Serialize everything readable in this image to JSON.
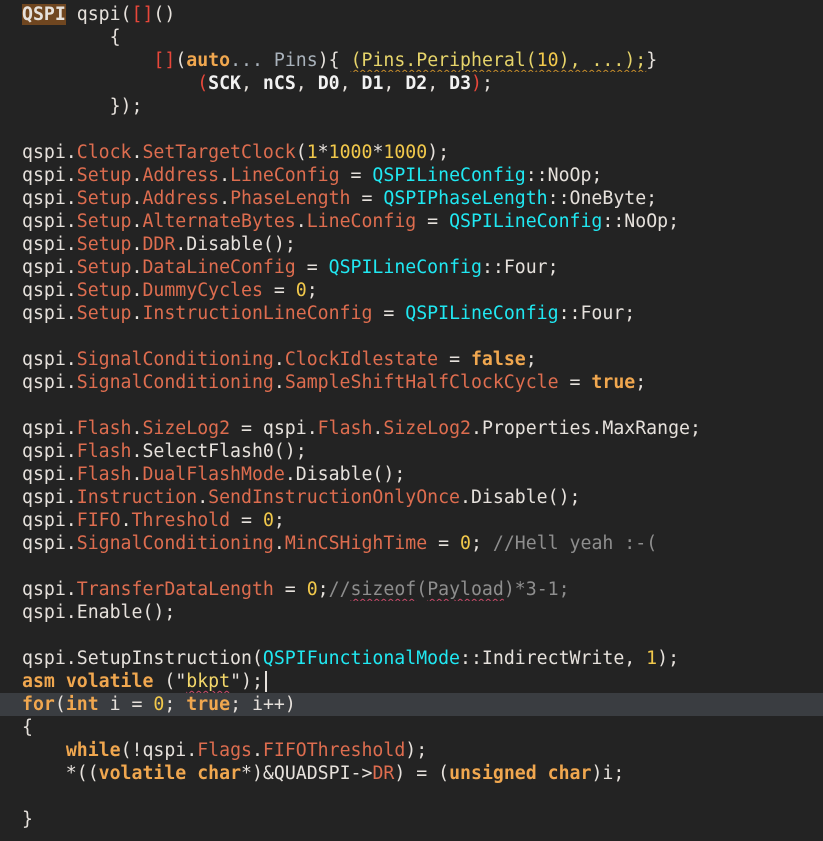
{
  "editor": {
    "background": "#232323",
    "current_line_background": "#3a3d41",
    "current_line": 30,
    "colors": {
      "plain": "#e6e1dc",
      "member": "#de6d4f",
      "type": "#20e8f2",
      "number": "#f1c84b",
      "keyword": "#f0a74f",
      "comment": "#8e8e8e",
      "string": "#f3d76a",
      "bracket": "#e8473a"
    },
    "lines": [
      [
        [
          "highlight",
          "QSPI"
        ],
        [
          "plain",
          " qspi("
        ],
        [
          "bracket",
          "[]"
        ],
        [
          "plain",
          "()"
        ]
      ],
      [
        [
          "plain",
          "        {"
        ]
      ],
      [
        [
          "plain",
          "            "
        ],
        [
          "bracket",
          "[]"
        ],
        [
          "plain",
          "("
        ],
        [
          "keyword",
          "auto"
        ],
        [
          "dim",
          "..."
        ],
        [
          "plain",
          " "
        ],
        [
          "dim",
          "Pins"
        ],
        [
          "plain",
          "){ "
        ],
        [
          "warn",
          "(Pins.Peripheral("
        ],
        [
          "warnnum",
          "10"
        ],
        [
          "warn"
        ],
        [
          "warn",
          "), ...);"
        ],
        [
          "plain",
          "}"
        ]
      ],
      [
        [
          "plain",
          "                "
        ],
        [
          "bracket",
          "("
        ],
        [
          "param",
          "SCK"
        ],
        [
          "plain",
          ", "
        ],
        [
          "param",
          "nCS"
        ],
        [
          "plain",
          ", "
        ],
        [
          "param",
          "D0"
        ],
        [
          "plain",
          ", "
        ],
        [
          "param",
          "D1"
        ],
        [
          "plain",
          ", "
        ],
        [
          "param",
          "D2"
        ],
        [
          "plain",
          ", "
        ],
        [
          "param",
          "D3"
        ],
        [
          "bracket",
          ")"
        ],
        [
          "plain",
          ";"
        ]
      ],
      [
        [
          "plain",
          "        });"
        ]
      ],
      [],
      [
        [
          "plain",
          "qspi."
        ],
        [
          "member",
          "Clock"
        ],
        [
          "plain",
          "."
        ],
        [
          "member",
          "SetTargetClock"
        ],
        [
          "plain",
          "("
        ],
        [
          "number",
          "1"
        ],
        [
          "plain",
          "*"
        ],
        [
          "number",
          "1000"
        ],
        [
          "plain",
          "*"
        ],
        [
          "number",
          "1000"
        ],
        [
          "plain",
          ");"
        ]
      ],
      [
        [
          "plain",
          "qspi."
        ],
        [
          "member",
          "Setup"
        ],
        [
          "plain",
          "."
        ],
        [
          "member",
          "Address"
        ],
        [
          "plain",
          "."
        ],
        [
          "member",
          "LineConfig"
        ],
        [
          "plain",
          " = "
        ],
        [
          "type",
          "QSPILineConfig"
        ],
        [
          "plain",
          "::NoOp;"
        ]
      ],
      [
        [
          "plain",
          "qspi."
        ],
        [
          "member",
          "Setup"
        ],
        [
          "plain",
          "."
        ],
        [
          "member",
          "Address"
        ],
        [
          "plain",
          "."
        ],
        [
          "member",
          "PhaseLength"
        ],
        [
          "plain",
          " = "
        ],
        [
          "type",
          "QSPIPhaseLength"
        ],
        [
          "plain",
          "::OneByte;"
        ]
      ],
      [
        [
          "plain",
          "qspi."
        ],
        [
          "member",
          "Setup"
        ],
        [
          "plain",
          "."
        ],
        [
          "member",
          "AlternateBytes"
        ],
        [
          "plain",
          "."
        ],
        [
          "member",
          "LineConfig"
        ],
        [
          "plain",
          " = "
        ],
        [
          "type",
          "QSPILineConfig"
        ],
        [
          "plain",
          "::NoOp;"
        ]
      ],
      [
        [
          "plain",
          "qspi."
        ],
        [
          "member",
          "Setup"
        ],
        [
          "plain",
          "."
        ],
        [
          "member",
          "DDR"
        ],
        [
          "plain",
          "."
        ],
        [
          "plain",
          "Disable();"
        ]
      ],
      [
        [
          "plain",
          "qspi."
        ],
        [
          "member",
          "Setup"
        ],
        [
          "plain",
          "."
        ],
        [
          "member",
          "DataLineConfig"
        ],
        [
          "plain",
          " = "
        ],
        [
          "type",
          "QSPILineConfig"
        ],
        [
          "plain",
          "::Four;"
        ]
      ],
      [
        [
          "plain",
          "qspi."
        ],
        [
          "member",
          "Setup"
        ],
        [
          "plain",
          "."
        ],
        [
          "member",
          "DummyCycles"
        ],
        [
          "plain",
          " = "
        ],
        [
          "number",
          "0"
        ],
        [
          "plain",
          ";"
        ]
      ],
      [
        [
          "plain",
          "qspi."
        ],
        [
          "member",
          "Setup"
        ],
        [
          "plain",
          "."
        ],
        [
          "member",
          "InstructionLineConfig"
        ],
        [
          "plain",
          " = "
        ],
        [
          "type",
          "QSPILineConfig"
        ],
        [
          "plain",
          "::Four;"
        ]
      ],
      [],
      [
        [
          "plain",
          "qspi."
        ],
        [
          "member",
          "SignalConditioning"
        ],
        [
          "plain",
          "."
        ],
        [
          "member",
          "ClockIdlestate"
        ],
        [
          "plain",
          " = "
        ],
        [
          "bool",
          "false"
        ],
        [
          "plain",
          ";"
        ]
      ],
      [
        [
          "plain",
          "qspi."
        ],
        [
          "member",
          "SignalConditioning"
        ],
        [
          "plain",
          "."
        ],
        [
          "member",
          "SampleShiftHalfClockCycle"
        ],
        [
          "plain",
          " = "
        ],
        [
          "bool",
          "true"
        ],
        [
          "plain",
          ";"
        ]
      ],
      [],
      [
        [
          "plain",
          "qspi."
        ],
        [
          "member",
          "Flash"
        ],
        [
          "plain",
          "."
        ],
        [
          "member",
          "SizeLog2"
        ],
        [
          "plain",
          " = qspi."
        ],
        [
          "member",
          "Flash"
        ],
        [
          "plain",
          "."
        ],
        [
          "member",
          "SizeLog2"
        ],
        [
          "plain",
          "."
        ],
        [
          "plain",
          "Properties.MaxRange;"
        ]
      ],
      [
        [
          "plain",
          "qspi."
        ],
        [
          "member",
          "Flash"
        ],
        [
          "plain",
          "."
        ],
        [
          "plain",
          "SelectFlash0();"
        ]
      ],
      [
        [
          "plain",
          "qspi."
        ],
        [
          "member",
          "Flash"
        ],
        [
          "plain",
          "."
        ],
        [
          "member",
          "DualFlashMode"
        ],
        [
          "plain",
          "."
        ],
        [
          "plain",
          "Disable();"
        ]
      ],
      [
        [
          "plain",
          "qspi."
        ],
        [
          "member",
          "Instruction"
        ],
        [
          "plain",
          "."
        ],
        [
          "member",
          "SendInstructionOnlyOnce"
        ],
        [
          "plain",
          "."
        ],
        [
          "plain",
          "Disable();"
        ]
      ],
      [
        [
          "plain",
          "qspi."
        ],
        [
          "member",
          "FIFO"
        ],
        [
          "plain",
          "."
        ],
        [
          "member",
          "Threshold"
        ],
        [
          "plain",
          " = "
        ],
        [
          "number",
          "0"
        ],
        [
          "plain",
          ";"
        ]
      ],
      [
        [
          "plain",
          "qspi."
        ],
        [
          "member",
          "SignalConditioning"
        ],
        [
          "plain",
          "."
        ],
        [
          "member",
          "MinCSHighTime"
        ],
        [
          "plain",
          " = "
        ],
        [
          "number",
          "0"
        ],
        [
          "plain",
          "; "
        ],
        [
          "comment",
          "//Hell yeah :-("
        ]
      ],
      [],
      [
        [
          "plain",
          "qspi."
        ],
        [
          "member",
          "TransferDataLength"
        ],
        [
          "plain",
          " = "
        ],
        [
          "number",
          "0"
        ],
        [
          "plain",
          ";"
        ],
        [
          "comment",
          "//"
        ],
        [
          "commenterr",
          "sizeof"
        ],
        [
          "comment",
          "("
        ],
        [
          "commenterr",
          "Payload"
        ],
        [
          "comment",
          ")*3-1;"
        ]
      ],
      [
        [
          "plain",
          "qspi."
        ],
        [
          "plain",
          "Enable();"
        ]
      ],
      [],
      [
        [
          "plain",
          "qspi."
        ],
        [
          "plain",
          "SetupInstruction("
        ],
        [
          "type",
          "QSPIFunctionalMode"
        ],
        [
          "plain",
          "::IndirectWrite, "
        ],
        [
          "number",
          "1"
        ],
        [
          "plain",
          ");"
        ]
      ],
      [
        [
          "keyword",
          "asm"
        ],
        [
          "plain",
          " "
        ],
        [
          "keyword",
          "volatile"
        ],
        [
          "plain",
          " (\""
        ],
        [
          "stringerr",
          "bkpt"
        ],
        [
          "plain",
          "\");"
        ]
      ],
      [
        [
          "keyword",
          "for"
        ],
        [
          "plain",
          "("
        ],
        [
          "keyword",
          "int"
        ],
        [
          "plain",
          " i = "
        ],
        [
          "number",
          "0"
        ],
        [
          "plain",
          "; "
        ],
        [
          "bool",
          "true"
        ],
        [
          "plain",
          "; i++)"
        ]
      ],
      [
        [
          "plain",
          "{"
        ]
      ],
      [
        [
          "plain",
          "    "
        ],
        [
          "keyword",
          "while"
        ],
        [
          "plain",
          "(!qspi."
        ],
        [
          "member",
          "Flags"
        ],
        [
          "plain",
          "."
        ],
        [
          "member",
          "FIFOThreshold"
        ],
        [
          "plain",
          ");"
        ]
      ],
      [
        [
          "plain",
          "    *(("
        ],
        [
          "keyword",
          "volatile"
        ],
        [
          "plain",
          " "
        ],
        [
          "keyword",
          "char"
        ],
        [
          "plain",
          "*)&QUADSPI->"
        ],
        [
          "member",
          "DR"
        ],
        [
          "plain",
          ") = ("
        ],
        [
          "keyword",
          "unsigned"
        ],
        [
          "plain",
          " "
        ],
        [
          "keyword",
          "char"
        ],
        [
          "plain",
          ")i;"
        ]
      ],
      [],
      [
        [
          "plain",
          "}"
        ]
      ]
    ]
  }
}
